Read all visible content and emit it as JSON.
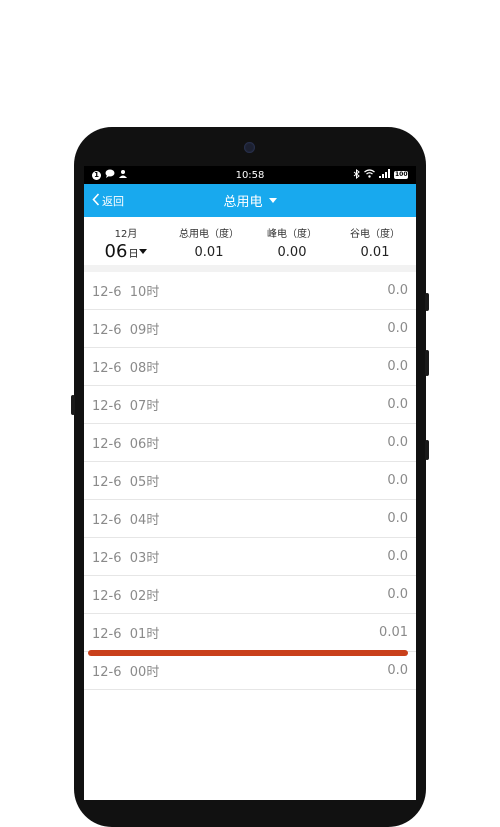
{
  "status_bar": {
    "time": "10:58",
    "notification_count": "1",
    "battery": "100"
  },
  "header": {
    "back_label": "返回",
    "title": "总用电"
  },
  "summary": {
    "month": "12月",
    "day": "06",
    "day_suffix": "日",
    "columns": [
      {
        "label": "总用电（度）",
        "value": "0.01"
      },
      {
        "label": "峰电（度）",
        "value": "0.00"
      },
      {
        "label": "谷电（度）",
        "value": "0.01"
      }
    ]
  },
  "hourly": [
    {
      "date": "12-6",
      "hour": "10时",
      "value": "0.0"
    },
    {
      "date": "12-6",
      "hour": "09时",
      "value": "0.0"
    },
    {
      "date": "12-6",
      "hour": "08时",
      "value": "0.0"
    },
    {
      "date": "12-6",
      "hour": "07时",
      "value": "0.0"
    },
    {
      "date": "12-6",
      "hour": "06时",
      "value": "0.0"
    },
    {
      "date": "12-6",
      "hour": "05时",
      "value": "0.0"
    },
    {
      "date": "12-6",
      "hour": "04时",
      "value": "0.0"
    },
    {
      "date": "12-6",
      "hour": "03时",
      "value": "0.0"
    },
    {
      "date": "12-6",
      "hour": "02时",
      "value": "0.0"
    },
    {
      "date": "12-6",
      "hour": "01时",
      "value": "0.01"
    },
    {
      "date": "12-6",
      "hour": "00时",
      "value": "0.0"
    }
  ],
  "colors": {
    "header_blue": "#18a9ee",
    "highlight_line": "#c9401b"
  }
}
